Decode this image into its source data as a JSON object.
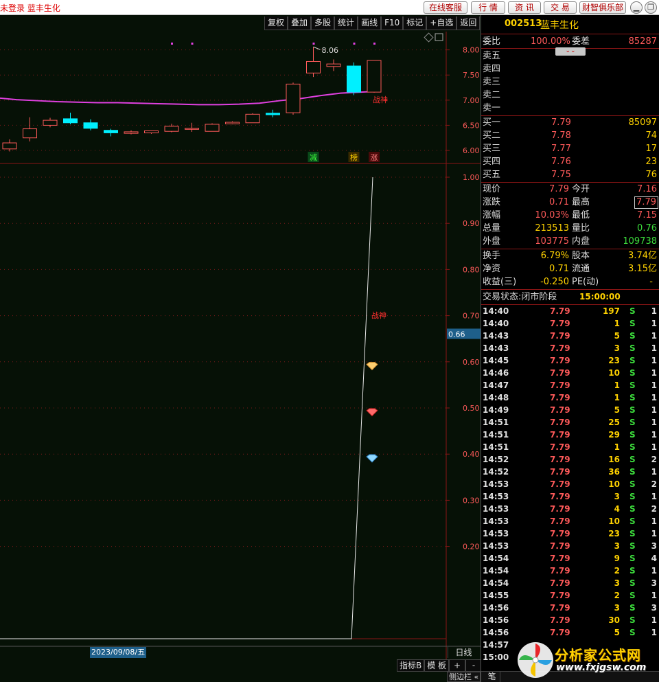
{
  "window": {
    "title": "未登录 蓝丰生化",
    "buttons": [
      "在线客服",
      "行  情",
      "资  讯",
      "交  易",
      "财智俱乐部"
    ],
    "win_controls": [
      "minimize",
      "restore"
    ]
  },
  "chart_toolbar": [
    "复权",
    "叠加",
    "多股",
    "统计",
    "画线",
    "F10",
    "标记",
    "+自选",
    "返回"
  ],
  "chart_data": [
    {
      "type": "candlestick",
      "title": "",
      "y_ticks": [
        "8.00",
        "7.50",
        "7.00",
        "6.50",
        "6.00"
      ],
      "ylim": [
        5.85,
        8.2
      ],
      "candles": [
        {
          "open": 6.03,
          "close": 6.15,
          "high": 6.22,
          "low": 5.98
        },
        {
          "open": 6.25,
          "close": 6.43,
          "high": 6.66,
          "low": 6.18
        },
        {
          "open": 6.5,
          "close": 6.6,
          "high": 6.65,
          "low": 6.46
        },
        {
          "open": 6.63,
          "close": 6.55,
          "high": 6.75,
          "low": 6.52
        },
        {
          "open": 6.55,
          "close": 6.44,
          "high": 6.62,
          "low": 6.4
        },
        {
          "open": 6.4,
          "close": 6.35,
          "high": 6.43,
          "low": 6.28
        },
        {
          "open": 6.34,
          "close": 6.37,
          "high": 6.4,
          "low": 6.32
        },
        {
          "open": 6.35,
          "close": 6.39,
          "high": 6.39,
          "low": 6.33
        },
        {
          "open": 6.38,
          "close": 6.48,
          "high": 6.53,
          "low": 6.36
        },
        {
          "open": 6.44,
          "close": 6.44,
          "high": 6.55,
          "low": 6.37
        },
        {
          "open": 6.38,
          "close": 6.52,
          "high": 6.54,
          "low": 6.38
        },
        {
          "open": 6.53,
          "close": 6.56,
          "high": 6.58,
          "low": 6.52
        },
        {
          "open": 6.55,
          "close": 6.72,
          "high": 6.74,
          "low": 6.55
        },
        {
          "open": 6.74,
          "close": 6.71,
          "high": 6.81,
          "low": 6.66
        },
        {
          "open": 6.75,
          "close": 7.32,
          "high": 7.35,
          "low": 6.71
        },
        {
          "open": 7.54,
          "close": 7.77,
          "high": 8.06,
          "low": 7.46
        },
        {
          "open": 7.67,
          "close": 7.72,
          "high": 7.81,
          "low": 7.58
        },
        {
          "open": 7.68,
          "close": 7.16,
          "high": 7.75,
          "low": 7.1
        },
        {
          "open": 7.16,
          "close": 7.79,
          "high": 7.79,
          "low": 7.15
        }
      ],
      "ma_series": [
        7.04,
        7.01,
        6.99,
        6.97,
        6.96,
        6.95,
        6.95,
        6.94,
        6.93,
        6.92,
        6.91,
        6.91,
        6.92,
        6.94,
        6.99,
        7.03,
        7.09,
        7.14,
        7.16,
        7.18
      ],
      "annotations": {
        "high_label": "8.06",
        "signal_text": "战神",
        "markers": [
          "减",
          "榜",
          "涨"
        ]
      }
    },
    {
      "type": "line",
      "title": "",
      "y_ticks": [
        "1.00",
        "0.90",
        "0.80",
        "0.70",
        "0.66",
        "0.60",
        "0.50",
        "0.40",
        "0.30",
        "0.20"
      ],
      "ylim": [
        0.0,
        1.0
      ],
      "values": [
        0.0,
        0.0,
        1.0
      ],
      "annotation": "战神",
      "diamond_levels": [
        0.59,
        0.49,
        0.39
      ],
      "current_value": "0.66"
    }
  ],
  "chart_footer": {
    "date": "2023/09/08/五",
    "period": "日线",
    "tabs": [
      "指标B",
      "模 板",
      "+",
      "-"
    ],
    "sidebar_toggle": "侧边栏 «"
  },
  "quote": {
    "code": "002513",
    "name": "蓝丰生化",
    "weibi_label": "委比",
    "weibi": "100.00%",
    "weicha_label": "委差",
    "weicha": "85287",
    "sell_levels": [
      "卖五",
      "卖四",
      "卖三",
      "卖二",
      "卖一"
    ],
    "buy_levels": [
      {
        "label": "买一",
        "price": "7.79",
        "vol": "85097"
      },
      {
        "label": "买二",
        "price": "7.78",
        "vol": "74"
      },
      {
        "label": "买三",
        "price": "7.77",
        "vol": "17"
      },
      {
        "label": "买四",
        "price": "7.76",
        "vol": "23"
      },
      {
        "label": "买五",
        "price": "7.75",
        "vol": "76"
      }
    ],
    "stats": [
      {
        "l1": "现价",
        "v1": "7.79",
        "l2": "今开",
        "v2": "7.16"
      },
      {
        "l1": "涨跌",
        "v1": "0.71",
        "l2": "最高",
        "v2": "7.79"
      },
      {
        "l1": "涨幅",
        "v1": "10.03%",
        "l2": "最低",
        "v2": "7.15"
      },
      {
        "l1": "总量",
        "v1": "213513",
        "l2": "量比",
        "v2": "0.76"
      },
      {
        "l1": "外盘",
        "v1": "103775",
        "l2": "内盘",
        "v2": "109738"
      }
    ],
    "stats2": [
      {
        "l1": "换手",
        "v1": "6.79%",
        "l2": "股本",
        "v2": "3.74亿"
      },
      {
        "l1": "净资",
        "v1": "0.71",
        "l2": "流通",
        "v2": "3.15亿"
      },
      {
        "l1": "收益(三)",
        "v1": "-0.250",
        "l2": "PE(动)",
        "v2": "-"
      }
    ],
    "status_label": "交易状态:闭市阶段",
    "status_time": "15:00:00",
    "ticks": [
      [
        "14:40",
        "7.79",
        "197",
        "S",
        "1"
      ],
      [
        "14:40",
        "7.79",
        "1",
        "S",
        "1"
      ],
      [
        "14:43",
        "7.79",
        "5",
        "S",
        "1"
      ],
      [
        "14:43",
        "7.79",
        "3",
        "S",
        "1"
      ],
      [
        "14:45",
        "7.79",
        "23",
        "S",
        "1"
      ],
      [
        "14:46",
        "7.79",
        "10",
        "S",
        "1"
      ],
      [
        "14:47",
        "7.79",
        "1",
        "S",
        "1"
      ],
      [
        "14:48",
        "7.79",
        "1",
        "S",
        "1"
      ],
      [
        "14:49",
        "7.79",
        "5",
        "S",
        "1"
      ],
      [
        "14:51",
        "7.79",
        "25",
        "S",
        "1"
      ],
      [
        "14:51",
        "7.79",
        "29",
        "S",
        "1"
      ],
      [
        "14:51",
        "7.79",
        "1",
        "S",
        "1"
      ],
      [
        "14:52",
        "7.79",
        "16",
        "S",
        "2"
      ],
      [
        "14:52",
        "7.79",
        "36",
        "S",
        "1"
      ],
      [
        "14:53",
        "7.79",
        "10",
        "S",
        "2"
      ],
      [
        "14:53",
        "7.79",
        "3",
        "S",
        "1"
      ],
      [
        "14:53",
        "7.79",
        "4",
        "S",
        "2"
      ],
      [
        "14:53",
        "7.79",
        "10",
        "S",
        "1"
      ],
      [
        "14:53",
        "7.79",
        "23",
        "S",
        "1"
      ],
      [
        "14:53",
        "7.79",
        "3",
        "S",
        "3"
      ],
      [
        "14:54",
        "7.79",
        "9",
        "S",
        "4"
      ],
      [
        "14:54",
        "7.79",
        "2",
        "S",
        "1"
      ],
      [
        "14:54",
        "7.79",
        "3",
        "S",
        "3"
      ],
      [
        "14:55",
        "7.79",
        "2",
        "S",
        "1"
      ],
      [
        "14:56",
        "7.79",
        "3",
        "S",
        "3"
      ],
      [
        "14:56",
        "7.79",
        "30",
        "S",
        "1"
      ],
      [
        "14:56",
        "7.79",
        "5",
        "S",
        "1"
      ],
      [
        "14:57",
        "",
        "",
        "",
        ""
      ],
      [
        "15:00",
        "",
        "",
        "",
        ""
      ]
    ],
    "bottom_tab": "笔"
  },
  "watermark": {
    "title": "分析家公式网",
    "url": "www.fxjgsw.com"
  },
  "colors": {
    "up": "#ff5a5a",
    "down_fill": "#00f0ff",
    "ma": "#e040e0",
    "grid": "#7a1a1a",
    "accent": "#ffd200"
  }
}
